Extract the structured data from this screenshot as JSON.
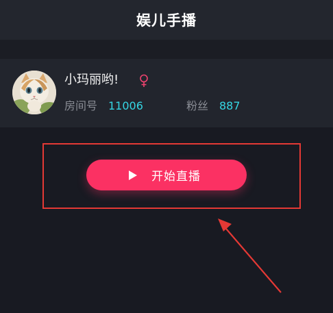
{
  "header": {
    "title": "娱儿手播"
  },
  "profile": {
    "name": "小玛丽哟!",
    "gender_icon": "female-icon",
    "room_label": "房间号",
    "room_value": "11006",
    "fans_label": "粉丝",
    "fans_value": "887"
  },
  "action": {
    "start_label": "开始直播",
    "play_icon": "play-icon"
  },
  "colors": {
    "accent": "#fb3163",
    "stat_value": "#35d6e4",
    "annotation": "#e53935"
  }
}
